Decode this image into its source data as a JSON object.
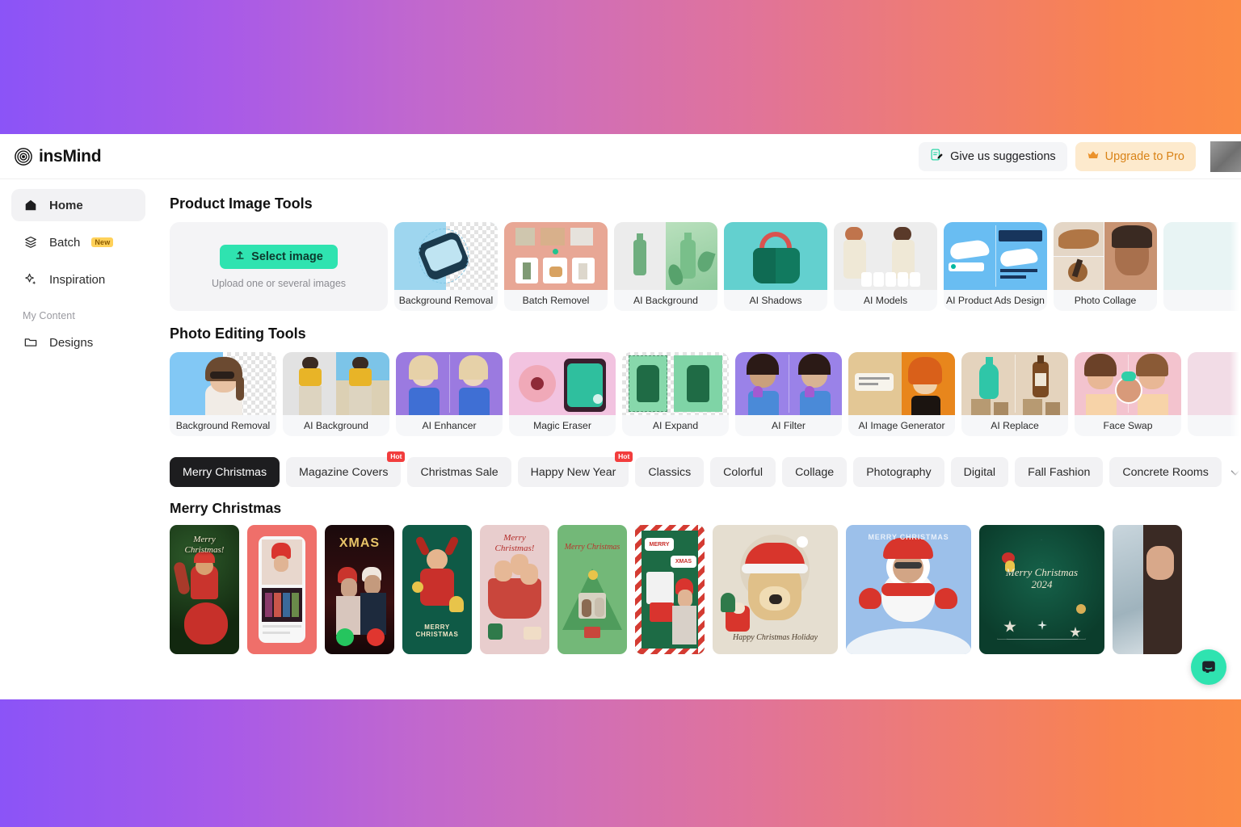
{
  "header": {
    "brand": "insMind",
    "brand_icon": "insmind-logo-icon",
    "suggestions_label": "Give us suggestions",
    "suggestions_icon": "feedback-note-icon",
    "upgrade_label": "Upgrade to Pro",
    "upgrade_icon": "crown-icon",
    "avatar": "user-avatar"
  },
  "sidebar": {
    "items": [
      {
        "label": "Home",
        "icon": "home-icon",
        "active": true,
        "badge": ""
      },
      {
        "label": "Batch",
        "icon": "layers-icon",
        "active": false,
        "badge": "New"
      },
      {
        "label": "Inspiration",
        "icon": "sparkle-icon",
        "active": false,
        "badge": ""
      }
    ],
    "group_label": "My Content",
    "content_items": [
      {
        "label": "Designs",
        "icon": "folder-icon"
      }
    ]
  },
  "main": {
    "product_section_title": "Product Image Tools",
    "upload": {
      "button_label": "Select image",
      "button_icon": "upload-arrow-icon",
      "hint": "Upload one or several images",
      "accent": "#2fe3b0"
    },
    "product_tools": [
      {
        "label": "Background Removal",
        "thumb": "smartwatch-cutout"
      },
      {
        "label": "Batch Removel",
        "thumb": "batch-product-grid"
      },
      {
        "label": "AI Background",
        "thumb": "green-bottle-scene"
      },
      {
        "label": "AI Shadows",
        "thumb": "green-handbag"
      },
      {
        "label": "AI Models",
        "thumb": "two-fashion-models"
      },
      {
        "label": "AI Product Ads Design",
        "thumb": "sneaker-poster"
      },
      {
        "label": "Photo Collage",
        "thumb": "makeup-collage"
      },
      {
        "label": "",
        "thumb": "partial-card"
      }
    ],
    "editing_section_title": "Photo Editing Tools",
    "editing_tools": [
      {
        "label": "Background Removal",
        "thumb": "woman-sunglasses-cutout"
      },
      {
        "label": "AI Background",
        "thumb": "yellow-top-woman-beach"
      },
      {
        "label": "AI Enhancer",
        "thumb": "blonde-woman-blue-blazer"
      },
      {
        "label": "Magic Eraser",
        "thumb": "donut-eraser"
      },
      {
        "label": "AI Expand",
        "thumb": "green-hoodie-expand"
      },
      {
        "label": "AI Filter",
        "thumb": "girl-tulips-cartoon"
      },
      {
        "label": "AI Image Generator",
        "thumb": "prompt-girl-with-flowers"
      },
      {
        "label": "AI Replace",
        "thumb": "bottle-replace"
      },
      {
        "label": "Face Swap",
        "thumb": "face-swap-girls"
      },
      {
        "label": "",
        "thumb": "partial-card"
      }
    ],
    "chips": [
      {
        "label": "Merry Christmas",
        "active": true,
        "badge": ""
      },
      {
        "label": "Magazine Covers",
        "active": false,
        "badge": "Hot"
      },
      {
        "label": "Christmas Sale",
        "active": false,
        "badge": ""
      },
      {
        "label": "Happy New Year",
        "active": false,
        "badge": "Hot"
      },
      {
        "label": "Classics",
        "active": false,
        "badge": ""
      },
      {
        "label": "Colorful",
        "active": false,
        "badge": ""
      },
      {
        "label": "Collage",
        "active": false,
        "badge": ""
      },
      {
        "label": "Photography",
        "active": false,
        "badge": ""
      },
      {
        "label": "Digital",
        "active": false,
        "badge": ""
      },
      {
        "label": "Fall Fashion",
        "active": false,
        "badge": ""
      },
      {
        "label": "Concrete Rooms",
        "active": false,
        "badge": ""
      }
    ],
    "chips_expand_icon": "chevron-down-icon",
    "gallery_title": "Merry Christmas",
    "templates": [
      {
        "name": "merry-christmas-tree-portrait",
        "shape": "portrait",
        "text": "Merry Christmas!"
      },
      {
        "name": "phone-call-santa-selfie",
        "shape": "portrait",
        "text": ""
      },
      {
        "name": "xmas-couple-dark",
        "shape": "portrait",
        "text": "XMAS"
      },
      {
        "name": "green-reindeer-kid",
        "shape": "portrait",
        "text": "MERRY CHRISTMAS"
      },
      {
        "name": "pink-family-stocking",
        "shape": "portrait",
        "text": "Merry Christmas!"
      },
      {
        "name": "green-tree-family",
        "shape": "portrait",
        "text": "Merry Christmas"
      },
      {
        "name": "merry-xmas-gifts-speech",
        "shape": "portrait",
        "text": "MERRY / XMAS"
      },
      {
        "name": "golden-retriever-santa",
        "shape": "square",
        "text": "Happy Christmas Holiday"
      },
      {
        "name": "snowman-photo-frame",
        "shape": "square",
        "text": "MERRY CHRISTMAS"
      },
      {
        "name": "green-tree-2024",
        "shape": "square",
        "text": "Merry Christmas 2024"
      },
      {
        "name": "winter-forest-partial",
        "shape": "portrait",
        "text": ""
      }
    ],
    "chat_icon": "chat-bubble-icon"
  }
}
